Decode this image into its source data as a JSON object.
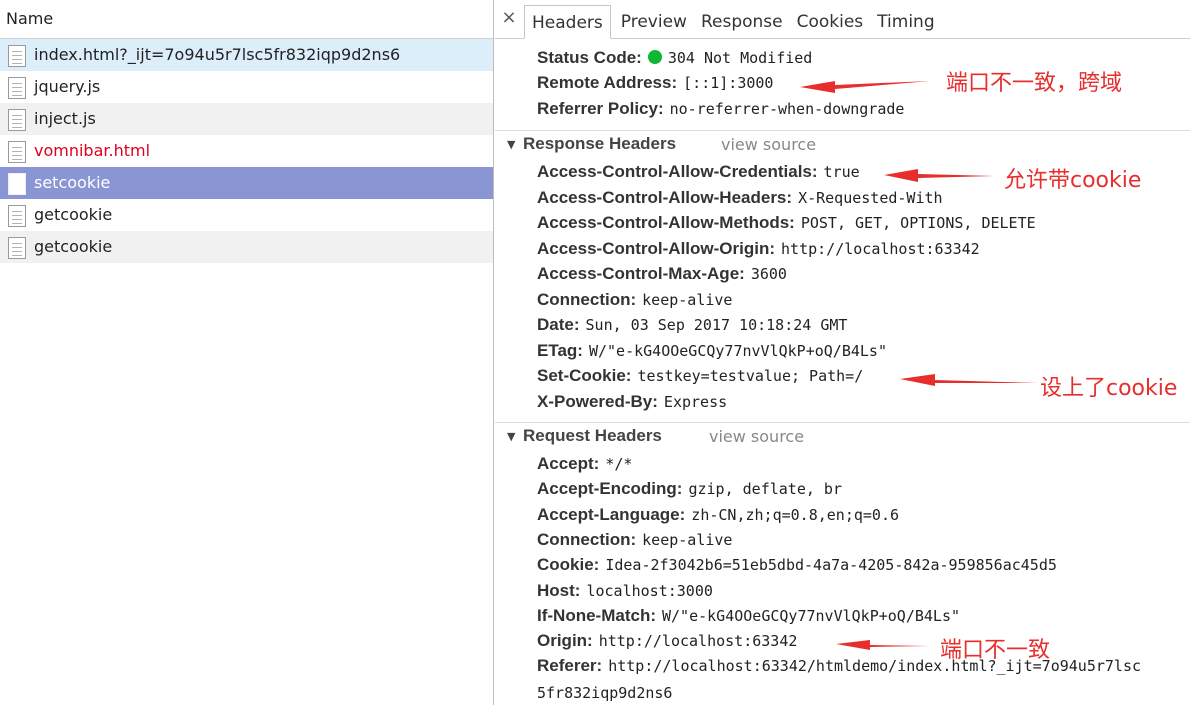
{
  "left": {
    "header": "Name",
    "requests": [
      {
        "name": "index.html?_ijt=7o94u5r7lsc5fr832iqp9d2ns6",
        "style": "first"
      },
      {
        "name": "jquery.js",
        "style": "normal"
      },
      {
        "name": "inject.js",
        "style": "alt"
      },
      {
        "name": "vomnibar.html",
        "style": "red"
      },
      {
        "name": "setcookie",
        "style": "selected"
      },
      {
        "name": "getcookie",
        "style": "normal"
      },
      {
        "name": "getcookie",
        "style": "alt"
      }
    ]
  },
  "tabs": {
    "close": "×",
    "items": [
      "Headers",
      "Preview",
      "Response",
      "Cookies",
      "Timing"
    ],
    "active": "Headers"
  },
  "general": {
    "status_code_key": "Status Code:",
    "status_code_value": "304 Not Modified",
    "remote_address_key": "Remote Address:",
    "remote_address_value": "[::1]:3000",
    "referrer_policy_key": "Referrer Policy:",
    "referrer_policy_value": "no-referrer-when-downgrade"
  },
  "response_headers": {
    "title": "Response Headers",
    "view_source": "view source",
    "items": [
      {
        "key": "Access-Control-Allow-Credentials:",
        "value": "true"
      },
      {
        "key": "Access-Control-Allow-Headers:",
        "value": "X-Requested-With"
      },
      {
        "key": "Access-Control-Allow-Methods:",
        "value": "POST, GET, OPTIONS, DELETE"
      },
      {
        "key": "Access-Control-Allow-Origin:",
        "value": "http://localhost:63342"
      },
      {
        "key": "Access-Control-Max-Age:",
        "value": "3600"
      },
      {
        "key": "Connection:",
        "value": "keep-alive"
      },
      {
        "key": "Date:",
        "value": "Sun, 03 Sep 2017 10:18:24 GMT"
      },
      {
        "key": "ETag:",
        "value": "W/\"e-kG4OOeGCQy77nvVlQkP+oQ/B4Ls\""
      },
      {
        "key": "Set-Cookie:",
        "value": "testkey=testvalue; Path=/"
      },
      {
        "key": "X-Powered-By:",
        "value": "Express"
      }
    ]
  },
  "request_headers": {
    "title": "Request Headers",
    "view_source": "view source",
    "items": [
      {
        "key": "Accept:",
        "value": "*/*"
      },
      {
        "key": "Accept-Encoding:",
        "value": "gzip, deflate, br"
      },
      {
        "key": "Accept-Language:",
        "value": "zh-CN,zh;q=0.8,en;q=0.6"
      },
      {
        "key": "Connection:",
        "value": "keep-alive"
      },
      {
        "key": "Cookie:",
        "value": "Idea-2f3042b6=51eb5dbd-4a7a-4205-842a-959856ac45d5"
      },
      {
        "key": "Host:",
        "value": "localhost:3000"
      },
      {
        "key": "If-None-Match:",
        "value": "W/\"e-kG4OOeGCQy77nvVlQkP+oQ/B4Ls\""
      },
      {
        "key": "Origin:",
        "value": "http://localhost:63342"
      },
      {
        "key": "Referer:",
        "value": "http://localhost:63342/htmldemo/index.html?_ijt=7o94u5r7lsc"
      }
    ],
    "referer_continued": "5fr832iqp9d2ns6"
  },
  "annotations": {
    "cross_origin": "端口不一致，跨域",
    "allow_cookie": "允许带cookie",
    "cookie_set": "设上了cookie",
    "port_mismatch": "端口不一致"
  },
  "colors": {
    "selected_row": "#8a95d4",
    "first_row": "#ddeefb",
    "annotation": "#e82d2d",
    "status_ok": "#0fb833",
    "error_text": "#e0001c"
  }
}
